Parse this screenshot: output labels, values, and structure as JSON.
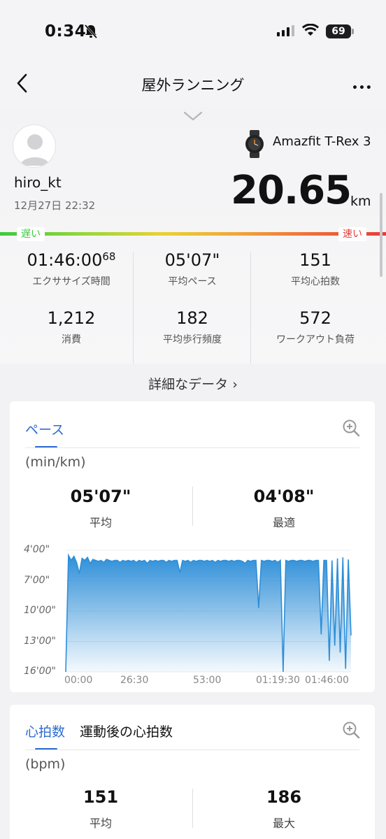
{
  "status_bar": {
    "time": "0:34",
    "battery": "69"
  },
  "nav": {
    "title": "屋外ランニング",
    "more": "•••"
  },
  "profile": {
    "username": "hiro_kt",
    "datetime": "12月27日 22:32",
    "device": "Amazfit T-Rex 3"
  },
  "distance": {
    "value": "20.65",
    "unit": "km"
  },
  "speed_bar": {
    "slow": "遅い",
    "fast": "速い"
  },
  "stats": [
    {
      "value": "01:46:00",
      "value_sup": "68",
      "label": "エクササイズ時間"
    },
    {
      "value": "05'07\"",
      "label": "平均ペース"
    },
    {
      "value": "151",
      "label": "平均心拍数"
    },
    {
      "value": "1,212",
      "label": "消費"
    },
    {
      "value": "182",
      "label": "平均歩行頻度"
    },
    {
      "value": "572",
      "label": "ワークアウト負荷"
    }
  ],
  "detail_link": "詳細なデータ ›",
  "pace_card": {
    "tab": "ペース",
    "unit": "(min/km)",
    "avg": {
      "value": "05'07\"",
      "label": "平均"
    },
    "best": {
      "value": "04'08\"",
      "label": "最適"
    }
  },
  "chart_data": {
    "type": "area",
    "ylabel": "",
    "y_ticks": [
      "4'00\"",
      "7'00\"",
      "10'00\"",
      "13'00\"",
      "16'00\""
    ],
    "x_ticks": [
      "00:00",
      "26:30",
      "53:00",
      "01:19:30",
      "01:46:00"
    ],
    "ylim_minutes_per_km": [
      4,
      16
    ],
    "y_inverted": true,
    "color": "#2f8fd8",
    "series": [
      {
        "pace_min_per_km": [
          16.0,
          4.5,
          5.0,
          4.6,
          5.2,
          6.3,
          4.8,
          5.0,
          4.7,
          5.3,
          4.9,
          5.0,
          5.1,
          5.0,
          5.2,
          4.9,
          5.0,
          5.1,
          5.0,
          5.0,
          5.2,
          5.0,
          5.1,
          5.0,
          5.1,
          5.0,
          5.2,
          5.0,
          5.1,
          5.0,
          5.3,
          5.0,
          5.1,
          5.0,
          5.1,
          5.0,
          5.0,
          5.2,
          5.0,
          5.1,
          5.0,
          5.0,
          6.2,
          5.0,
          5.1,
          5.0,
          5.2,
          5.0,
          5.1,
          5.0,
          5.0,
          5.1,
          5.0,
          5.1,
          5.0,
          5.2,
          5.0,
          5.1,
          5.0,
          5.0,
          5.1,
          5.0,
          5.1,
          5.0,
          5.0,
          5.1,
          5.3,
          5.0,
          5.1,
          5.0,
          5.0,
          9.7,
          5.0,
          5.1,
          5.0,
          5.0,
          5.1,
          5.0,
          5.2,
          5.0,
          16.0,
          5.0,
          5.1,
          5.0,
          5.0,
          5.1,
          5.0,
          5.0,
          5.1,
          5.0,
          5.0,
          5.1,
          5.0,
          5.0,
          12.3,
          5.0,
          5.0,
          14.9,
          5.0,
          13.4,
          4.8,
          14.1,
          4.7,
          15.7,
          4.9,
          12.4
        ]
      }
    ]
  },
  "hr_card": {
    "tab_active": "心拍数",
    "tab_other": "運動後の心拍数",
    "unit": "(bpm)",
    "avg": {
      "value": "151",
      "label": "平均"
    },
    "max": {
      "value": "186",
      "label": "最大"
    }
  }
}
